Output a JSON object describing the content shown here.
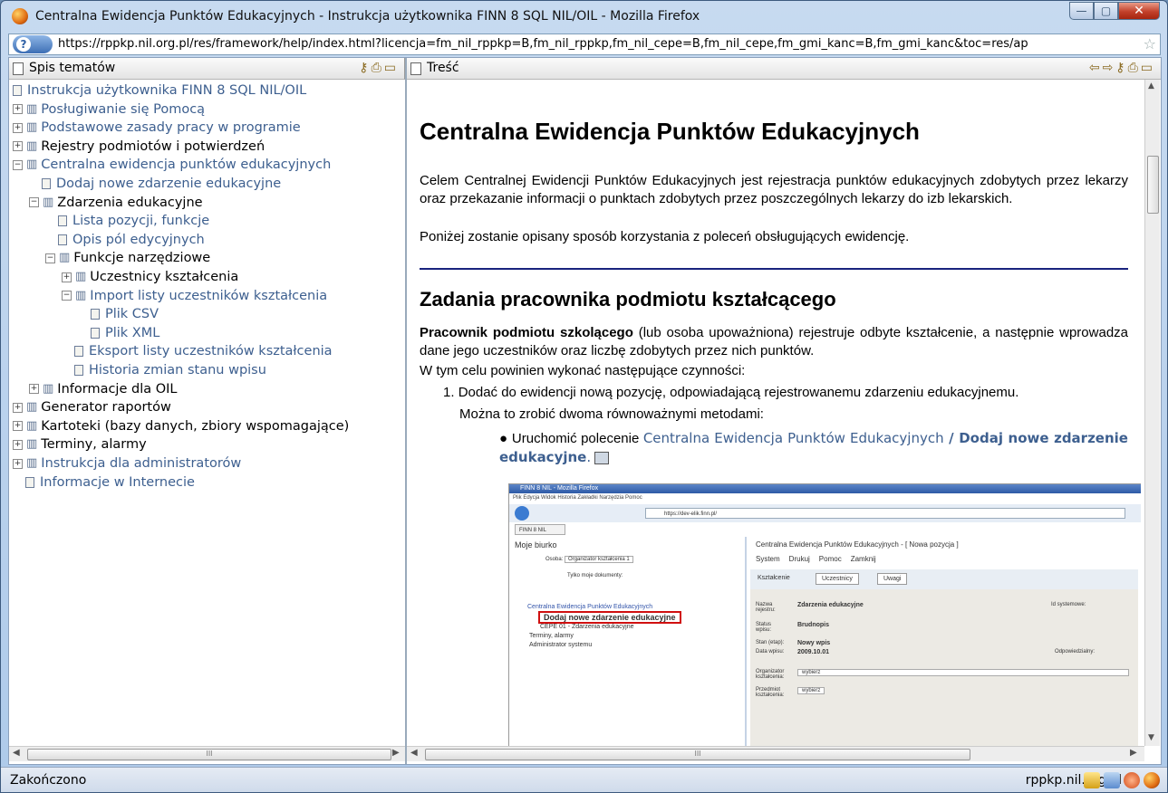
{
  "window": {
    "title": "Centralna Ewidencja Punktów Edukacyjnych - Instrukcja użytkownika FINN 8 SQL NIL/OIL - Mozilla Firefox",
    "url": "https://rppkp.nil.org.pl/res/framework/help/index.html?licencja=fm_nil_rppkp=B,fm_nil_rppkp,fm_nil_cepe=B,fm_nil_cepe,fm_gmi_kanc=B,fm_gmi_kanc&toc=res/ap"
  },
  "toc": {
    "title": "Spis tematów",
    "items": [
      {
        "label": "Instrukcja użytkownika FINN 8 SQL NIL/OIL",
        "level": 0,
        "type": "root",
        "link": true
      },
      {
        "label": "Posługiwanie się Pomocą",
        "level": 0,
        "type": "book",
        "link": true,
        "toggle": "+"
      },
      {
        "label": "Podstawowe zasady pracy w programie",
        "level": 0,
        "type": "book",
        "link": true,
        "toggle": "+"
      },
      {
        "label": "Rejestry podmiotów i potwierdzeń",
        "level": 0,
        "type": "book",
        "link": false,
        "toggle": "+"
      },
      {
        "label": "Centralna ewidencja punktów edukacyjnych",
        "level": 0,
        "type": "book",
        "link": true,
        "toggle": "−"
      },
      {
        "label": "Dodaj nowe zdarzenie edukacyjne",
        "level": 1,
        "type": "page",
        "link": true
      },
      {
        "label": "Zdarzenia edukacyjne",
        "level": 1,
        "type": "book",
        "link": false,
        "toggle": "−"
      },
      {
        "label": "Lista pozycji, funkcje",
        "level": 2,
        "type": "page",
        "link": true
      },
      {
        "label": "Opis pól edycyjnych",
        "level": 2,
        "type": "page",
        "link": true
      },
      {
        "label": "Funkcje narzędziowe",
        "level": 2,
        "type": "book",
        "link": false,
        "toggle": "−"
      },
      {
        "label": "Uczestnicy kształcenia",
        "level": 3,
        "type": "book",
        "link": false,
        "toggle": "+"
      },
      {
        "label": "Import listy uczestników kształcenia",
        "level": 3,
        "type": "book",
        "link": true,
        "toggle": "−"
      },
      {
        "label": "Plik CSV",
        "level": 4,
        "type": "page",
        "link": true
      },
      {
        "label": "Plik XML",
        "level": 4,
        "type": "page",
        "link": true
      },
      {
        "label": "Eksport listy uczestników kształcenia",
        "level": 3,
        "type": "page",
        "link": true
      },
      {
        "label": "Historia zmian stanu wpisu",
        "level": 3,
        "type": "page",
        "link": true
      },
      {
        "label": "Informacje dla OIL",
        "level": 1,
        "type": "book",
        "link": false,
        "toggle": "+"
      },
      {
        "label": "Generator raportów",
        "level": 0,
        "type": "book",
        "link": false,
        "toggle": "+"
      },
      {
        "label": "Kartoteki (bazy danych, zbiory wspomagające)",
        "level": 0,
        "type": "book",
        "link": false,
        "toggle": "+"
      },
      {
        "label": "Terminy, alarmy",
        "level": 0,
        "type": "book",
        "link": false,
        "toggle": "+"
      },
      {
        "label": "Instrukcja dla administratorów",
        "level": 0,
        "type": "book",
        "link": true,
        "toggle": "+"
      },
      {
        "label": "Informacje w Internecie",
        "level": 0,
        "type": "page",
        "link": true
      }
    ]
  },
  "content": {
    "pane_title": "Treść",
    "h1": "Centralna Ewidencja Punktów Edukacyjnych",
    "p1": "Celem Centralnej Ewidencji Punktów Edukacyjnych jest rejestracja punktów edukacyjnych zdobytych przez lekarzy oraz przekazanie informacji o punktach zdobytych przez poszczególnych lekarzy do izb lekarskich.",
    "p2": "Poniżej zostanie opisany sposób korzystania z poleceń obsługujących ewidencję.",
    "h2": "Zadania pracownika podmiotu kształcącego",
    "p3_bold": "Pracownik podmiotu szkolącego",
    "p3_rest": " (lub osoba upoważniona) rejestruje odbyte kształcenie, a następnie wprowadza dane jego uczestników oraz liczbę zdobytych przez nich punktów.",
    "p4": "W tym celu powinien wykonać następujące czynności:",
    "li1": "Dodać do ewidencji nową pozycję, odpowiadającą rejestrowanemu zdarzeniu edukacyjnemu.",
    "li1_sub": "Można to zrobić dwoma równoważnymi metodami:",
    "bullet_pre": "Uruchomić polecenie ",
    "bullet_link1": "Centralna Ewidencja Punktów Edukacyjnych",
    "bullet_sep": " / ",
    "bullet_link2": "Dodaj nowe zdarzenie edukacyjne",
    "bullet_end": "."
  },
  "screenshot": {
    "title": "FINN 8 NIL - Mozilla Firefox",
    "menu": "Plik  Edycja  Widok  Historia  Zakładki  Narzędzia  Pomoc",
    "url": "https://dev-elik.finn.pl/",
    "tab": "FINN 8 NIL",
    "left_title": "Moje biurko",
    "osoba_label": "Osoba:",
    "osoba_value": "Organizator kształcenia 1",
    "tylko": "Tylko moje dokumenty:",
    "tree1": "Centralna Ewidencja Punktów Edukacyjnych",
    "tree2": "Dodaj nowe zdarzenie edukacyjne",
    "tree3": "CEPE 01 - Zdarzenia edukacyjne",
    "tree4": "Terminy, alarmy",
    "tree5": "Administrator systemu",
    "right_title": "Centralna Ewidencja Punktów Edukacyjnych - [ Nowa pozycja ]",
    "tb_system": "System",
    "tb_drukuj": "Drukuj",
    "tb_pomoc": "Pomoc",
    "tb_zamknij": "Zamknij",
    "tab1": "Kształcenie",
    "tab2": "Uczestnicy",
    "tab3": "Uwagi",
    "f_nazwa": "Nazwa rejestru:",
    "f_nazwa_v": "Zdarzenia edukacyjne",
    "f_id": "Id systemowe:",
    "f_status": "Status wpisu:",
    "f_status_v": "Brudnopis",
    "f_stan": "Stan (etap):",
    "f_stan_v": "Nowy wpis",
    "f_data": "Data wpisu:",
    "f_data_v": "2009.10.01",
    "f_odp": "Odpowiedzialny:",
    "f_org": "Organizator kształcenia:",
    "f_org_v": "wybierz",
    "f_przed": "Przedmiot kształcenia:",
    "f_przed_v": "wybierz"
  },
  "status": {
    "text": "Zakończono",
    "domain": "rppkp.nil.org.pl"
  },
  "toc_hscroll_thumb": "III",
  "doc_hscroll_thumb": "III"
}
